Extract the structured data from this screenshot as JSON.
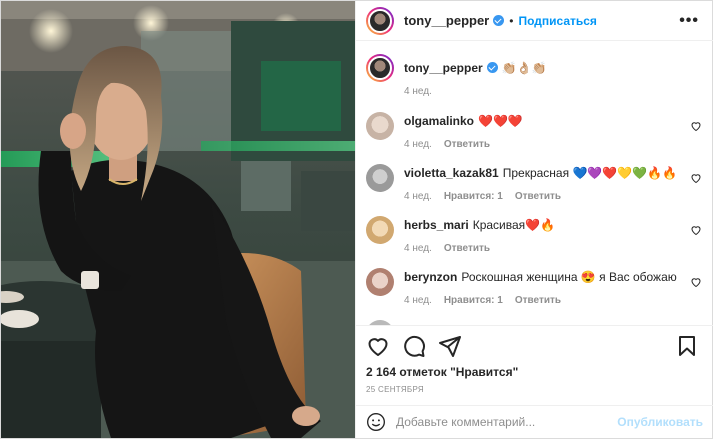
{
  "header": {
    "username": "tony__pepper",
    "dot": "•",
    "follow_label": "Подписаться",
    "more_label": "•••"
  },
  "caption": {
    "username": "tony__pepper",
    "text": "👏🏼👌🏼👏🏼",
    "time": "4 нед."
  },
  "comments": [
    {
      "username": "olgamalinko",
      "text": "❤️❤️❤️",
      "time": "4 нед.",
      "likes": "",
      "reply": "Ответить"
    },
    {
      "username": "violetta_kazak81",
      "text": "Прекрасная 💙💜❤️💛💚🔥🔥",
      "time": "4 нед.",
      "likes": "Нравится: 1",
      "reply": "Ответить"
    },
    {
      "username": "herbs_mari",
      "text": "Красивая❤️🔥",
      "time": "4 нед.",
      "likes": "",
      "reply": "Ответить"
    },
    {
      "username": "berynzon",
      "text": "Роскошная женщина 😍 я Вас обожаю",
      "time": "4 нед.",
      "likes": "Нравится: 1",
      "reply": "Ответить"
    }
  ],
  "likes": {
    "count": "2 164 отметок",
    "label": "\"Нравится\""
  },
  "date": "25 сентября",
  "add_comment": {
    "placeholder": "Добавьте комментарий...",
    "publish_label": "Опубликовать"
  },
  "icons": {
    "heart": "heart-icon",
    "comment": "comment-icon",
    "share": "share-icon",
    "save": "bookmark-icon",
    "emoji": "emoji-icon"
  },
  "colors": {
    "accent": "#0095f6",
    "verified": "#3897f0",
    "muted": "#8e8e8e",
    "publish_disabled": "#b2dffc"
  }
}
